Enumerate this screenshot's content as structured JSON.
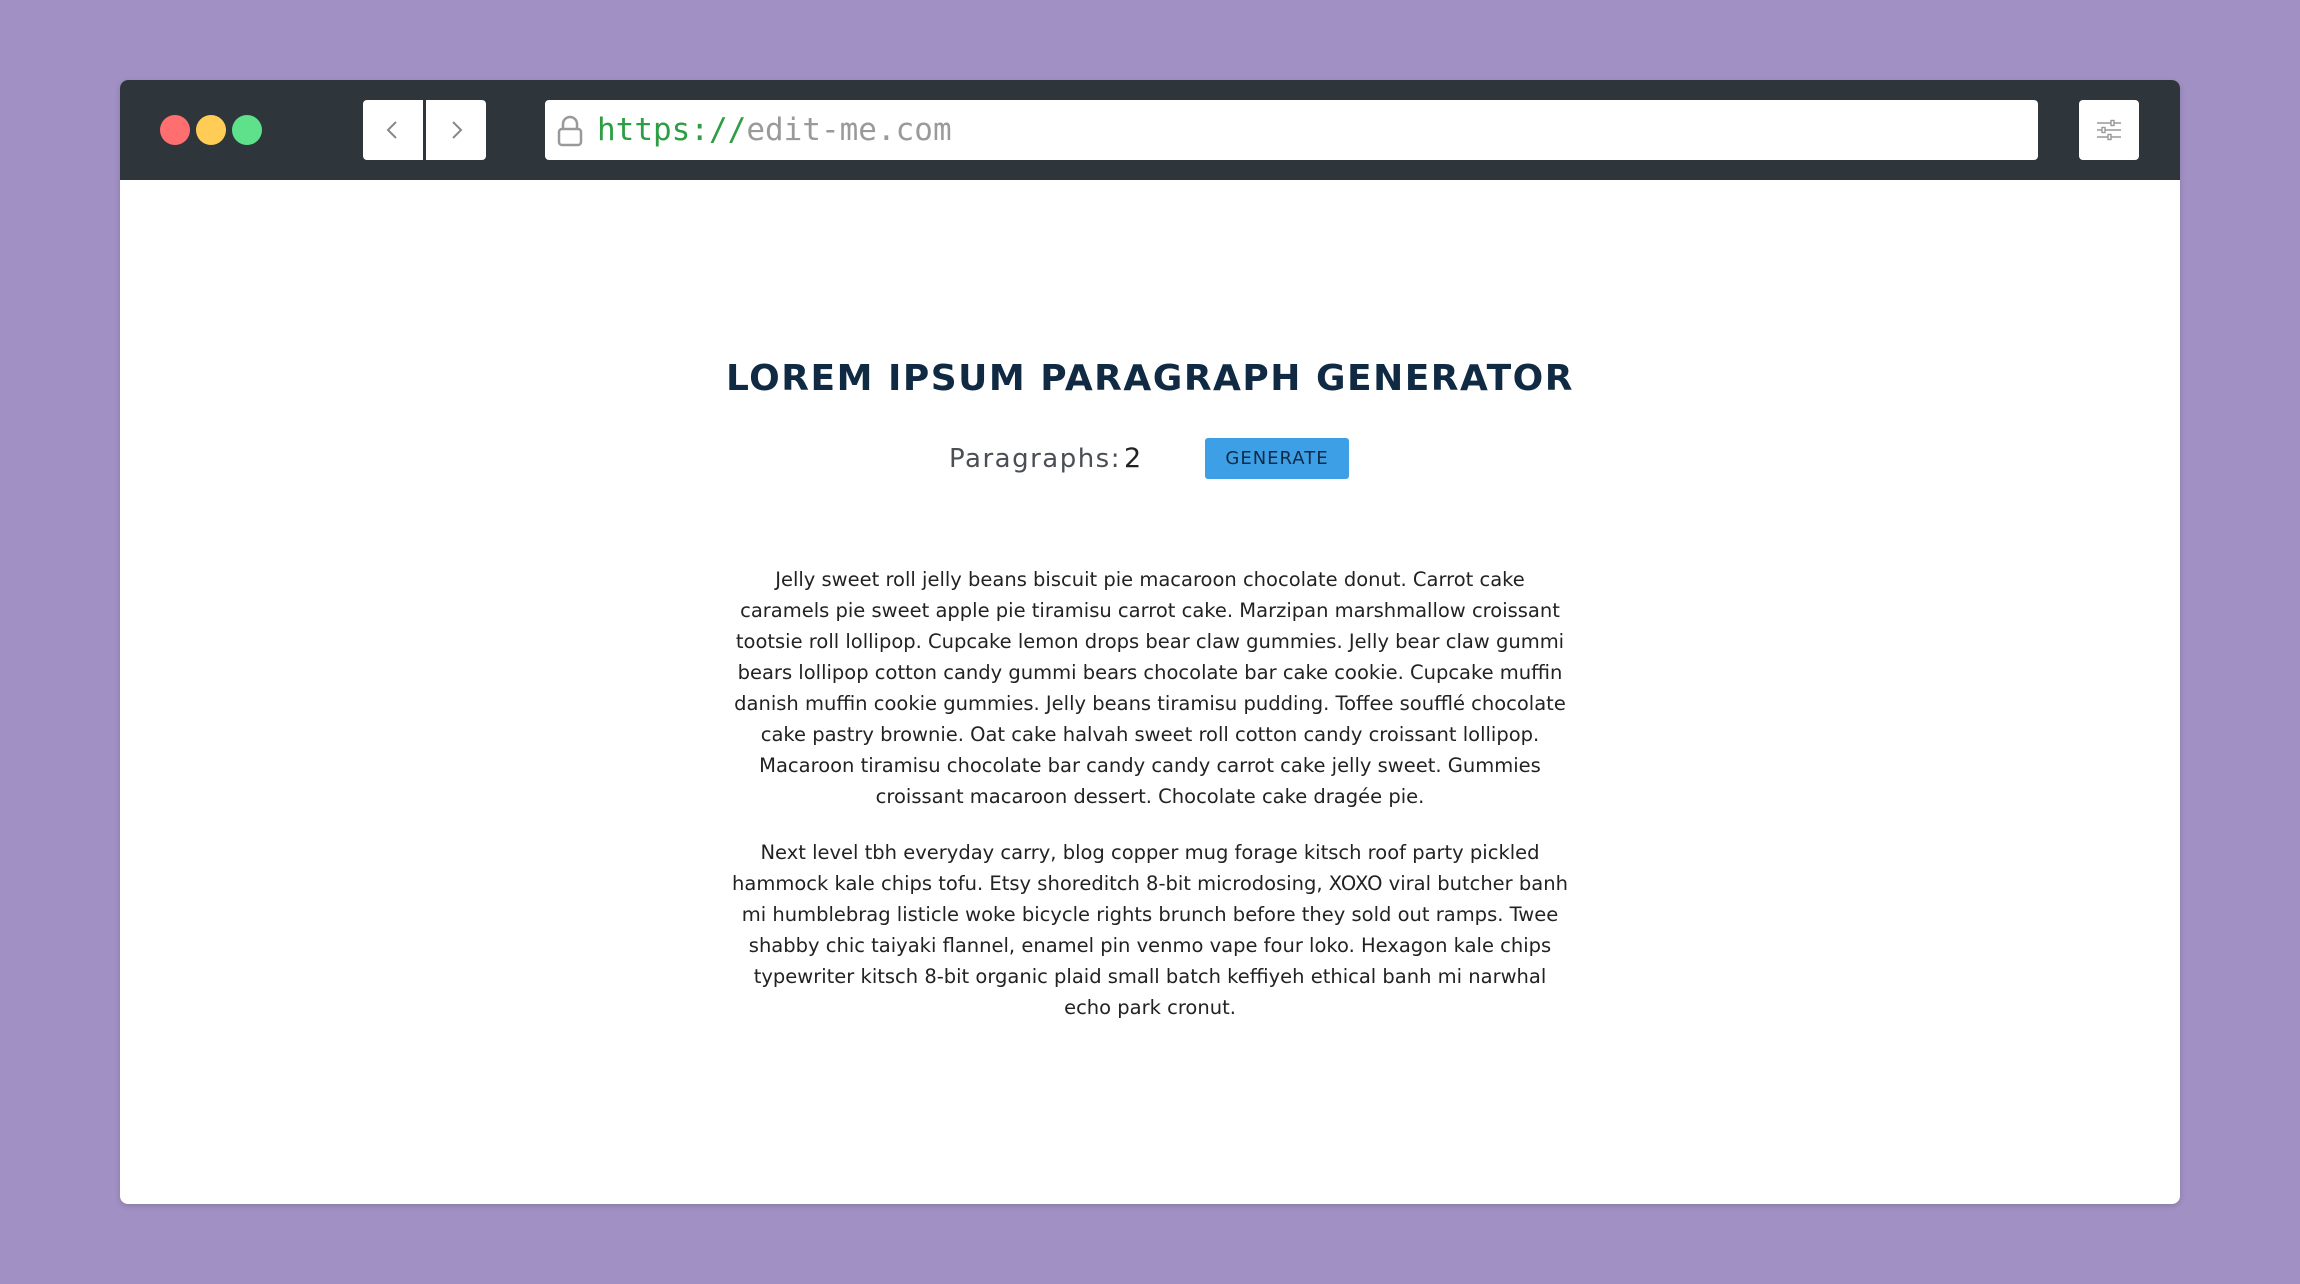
{
  "browser": {
    "url_scheme": "https://",
    "url_host": "edit-me.com"
  },
  "page": {
    "title": "LOREM IPSUM PARAGRAPH GENERATOR",
    "paragraphs_label": "Paragraphs:",
    "paragraphs_value": "2",
    "generate_label": "GENERATE",
    "paragraphs": [
      "Jelly sweet roll jelly beans biscuit pie macaroon chocolate donut. Carrot cake caramels pie sweet apple pie tiramisu carrot cake. Marzipan marshmallow croissant tootsie roll lollipop. Cupcake lemon drops bear claw gummies. Jelly bear claw gummi bears lollipop cotton candy gummi bears chocolate bar cake cookie. Cupcake muffin danish muffin cookie gummies. Jelly beans tiramisu pudding. Toffee soufflé chocolate cake pastry brownie. Oat cake halvah sweet roll cotton candy croissant lollipop. Macaroon tiramisu chocolate bar candy candy carrot cake jelly sweet. Gummies croissant macaroon dessert. Chocolate cake dragée pie.",
      "Next level tbh everyday carry, blog copper mug forage kitsch roof party pickled hammock kale chips tofu. Etsy shoreditch 8-bit microdosing, XOXO viral butcher banh mi humblebrag listicle woke bicycle rights brunch before they sold out ramps. Twee shabby chic taiyaki flannel, enamel pin venmo vape four loko. Hexagon kale chips typewriter kitsch 8-bit organic plaid small batch keffiyeh ethical banh mi narwhal echo park cronut."
    ]
  },
  "icons": {
    "back": "chevron-left-icon",
    "forward": "chevron-right-icon",
    "lock": "lock-icon",
    "settings": "sliders-icon"
  },
  "colors": {
    "background": "#a190c4",
    "titlebar": "#2e353b",
    "accent_button": "#3d9fe6",
    "title_text": "#102a44",
    "url_scheme": "#2e9e44"
  }
}
